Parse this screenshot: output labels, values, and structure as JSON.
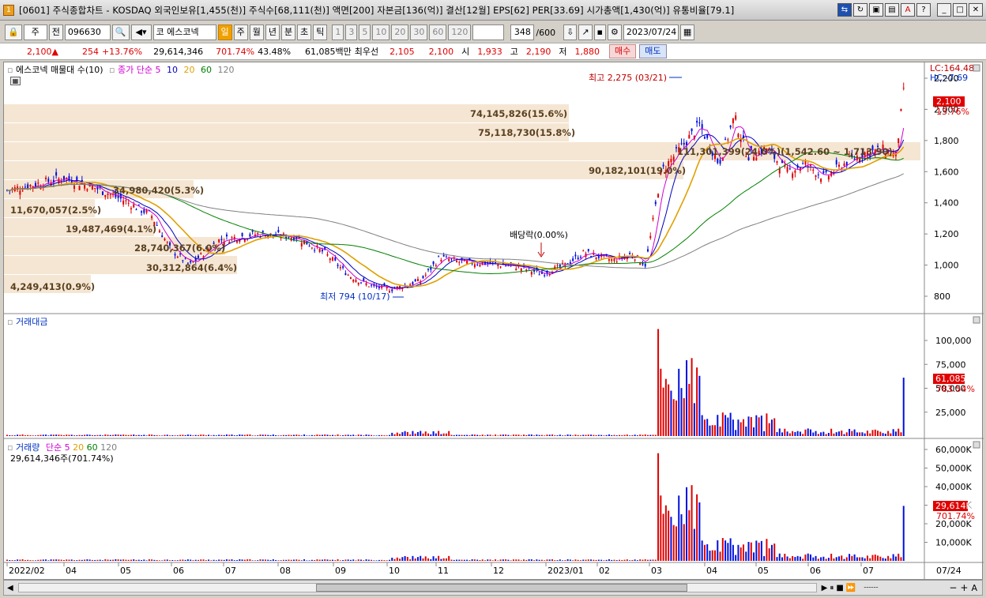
{
  "window": {
    "title": "[0601] 주식종합차트 - KOSDAQ 외국인보유[1,455(천)] 주식수[68,111(천)] 액면[200] 자본금[136(억)] 결산[12월] EPS[62] PER[33.69] 시가총액[1,430(억)] 유통비율[79.1]",
    "app_icon": "1"
  },
  "toolbar": {
    "mode": "주",
    "prev": "전",
    "code": "096630",
    "name": "코 에스코넥",
    "periods": [
      "일",
      "주",
      "월",
      "년",
      "분",
      "초",
      "틱"
    ],
    "selected_period": "일",
    "intervals": [
      "1",
      "3",
      "5",
      "10",
      "20",
      "30",
      "60",
      "120"
    ],
    "count": "348",
    "count_total": "/600",
    "date": "2023/07/24"
  },
  "quote": {
    "price": "2,100",
    "arrow": "▲",
    "change": "254",
    "rate": "+13.76%",
    "volume": "29,614,346",
    "vol_rate": "701.74%",
    "turnover": "43.48%",
    "amount": "61,085백만",
    "best_label": "최우선",
    "ask": "2,105",
    "bid": "2,100",
    "open_label": "시",
    "open": "1,933",
    "high_label": "고",
    "high": "2,190",
    "low_label": "저",
    "low": "1,880",
    "buy": "매수",
    "sell": "매도"
  },
  "panel1": {
    "legend": [
      "에스코넥 매물대 수(10)",
      "종가 단순",
      "5",
      "10",
      "20",
      "60",
      "120"
    ],
    "profile": [
      "74,145,826(15.6%)",
      "75,118,730(15.8%)",
      "111,301,399(24.0%)(1,542.60 ~ 1,713.90)",
      "90,182,101(19.0%)",
      "34,980,420(5.3%)",
      "11,670,057(2.5%)",
      "19,487,469(4.1%)",
      "28,740,367(6.0%)",
      "30,312,864(6.4%)",
      "4,249,413(0.9%)"
    ],
    "high_note": "최고 2,275 (03/21)",
    "low_note": "최저 794 (10/17)",
    "dividend_note": "배당락(0.00%)",
    "lc": "LC:164.48",
    "hc": "HC:-7.69",
    "price_tag": "2,100",
    "rate_tag": "13.76%",
    "yticks": [
      "2,200",
      "2,000",
      "1,800",
      "1,600",
      "1,400",
      "1,200",
      "1,000",
      "800"
    ]
  },
  "panel2": {
    "title": "거래대금",
    "yticks": [
      "100,000",
      "75,000",
      "50,000",
      "25,000"
    ],
    "tag": "61,085",
    "tag2": "783.54%"
  },
  "panel3": {
    "legend": [
      "거래량",
      "단순",
      "5",
      "20",
      "60",
      "120"
    ],
    "info": "29,614,346주(701.74%)",
    "yticks": [
      "60,000K",
      "50,000K",
      "40,000K",
      "30,000K",
      "20,000K",
      "10,000K"
    ],
    "tag": "29,614K",
    "tag2": "701.74%"
  },
  "xaxis": [
    "2022/02",
    "04",
    "05",
    "06",
    "07",
    "08",
    "09",
    "10",
    "11",
    "12",
    "2023/01",
    "02",
    "03",
    "04",
    "05",
    "06",
    "07"
  ],
  "xaxis_right": "07/24",
  "colors": {
    "up": "#e00000",
    "down": "#0010e0",
    "ma5": "#d000d0",
    "ma10": "#0000c0",
    "ma20": "#e0a000",
    "ma60": "#008000",
    "ma120": "#808080",
    "profile": "#f5e6d3"
  }
}
